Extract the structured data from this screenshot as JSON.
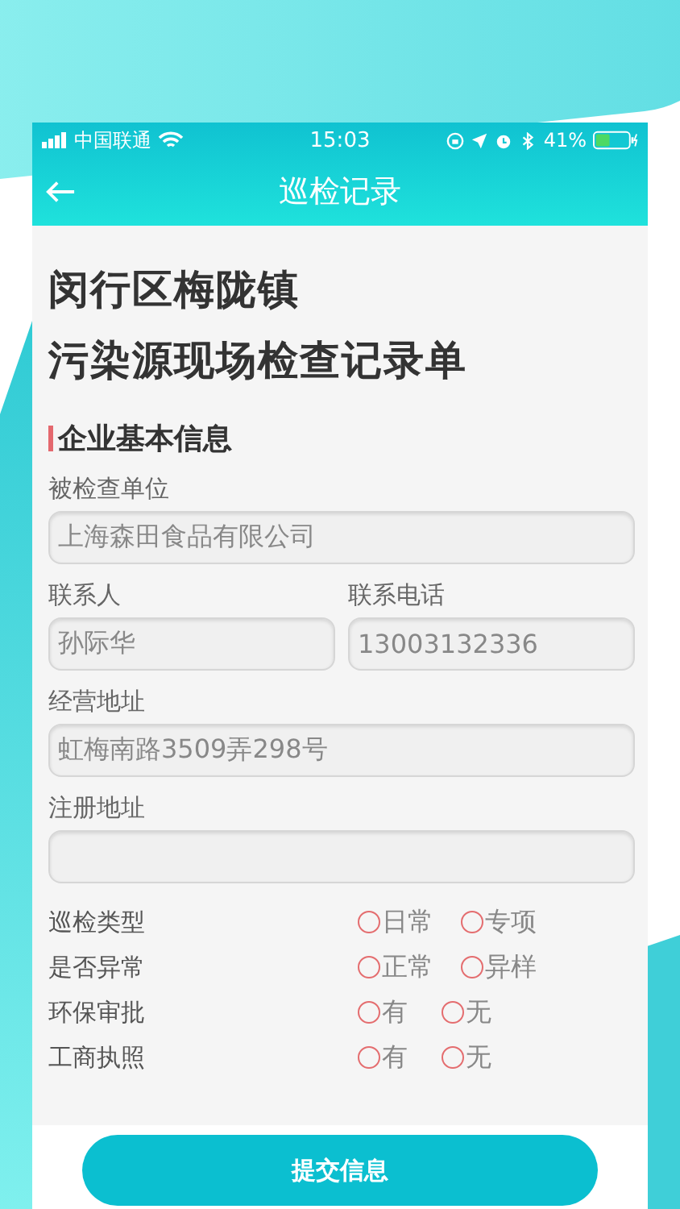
{
  "status_bar": {
    "carrier": "中国联通",
    "time": "15:03",
    "battery": "41%"
  },
  "nav_bar": {
    "title": "巡检记录"
  },
  "form_title": [
    "闵行区梅陇镇",
    "污染源现场检查记录单"
  ],
  "section": {
    "title": "企业基本信息"
  },
  "fields": [
    {
      "label": "被检查单位",
      "value": "上海森田食品有限公司"
    }
  ],
  "field_pair": [
    {
      "label": "联系人",
      "value": "孙际华"
    },
    {
      "label": "联系电话",
      "value": "13003132336"
    }
  ],
  "fields_after": [
    {
      "label": "经营地址",
      "value": "虹梅南路3509弄298号"
    },
    {
      "label": "注册地址"
    }
  ],
  "radio_groups": [
    {
      "label": "巡检类型",
      "options": [
        {
          "label": "日常",
          "selected": false
        },
        {
          "label": "专项",
          "selected": false
        }
      ]
    },
    {
      "label": "是否异常",
      "options": [
        {
          "label": "正常",
          "selected": false
        },
        {
          "label": "异样",
          "selected": false
        }
      ]
    },
    {
      "label": "环保审批",
      "options": [
        {
          "label": "有",
          "selected": false
        },
        {
          "label": "无",
          "selected": false
        }
      ]
    },
    {
      "label": "工商执照",
      "options": [
        {
          "label": "有",
          "selected": false
        },
        {
          "label": "无",
          "selected": false
        }
      ]
    }
  ],
  "submit_button": "提交信息"
}
